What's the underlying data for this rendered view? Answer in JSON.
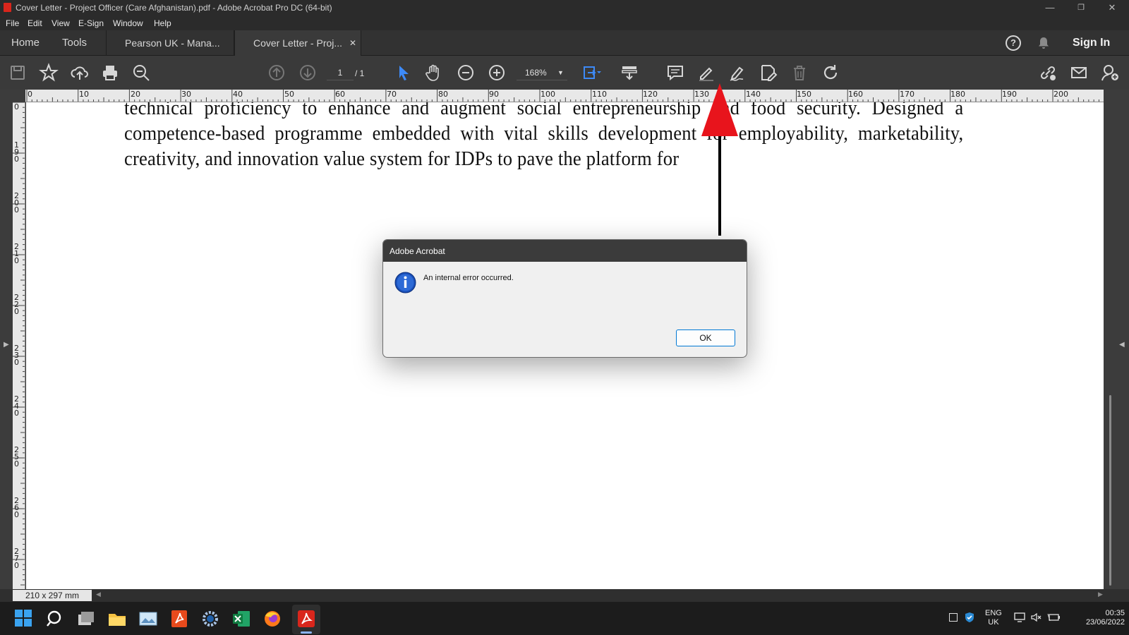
{
  "window": {
    "title": "Cover Letter - Project Officer (Care Afghanistan).pdf - Adobe Acrobat Pro DC (64-bit)",
    "controls": [
      "minimize",
      "restore",
      "close"
    ]
  },
  "menu": [
    "File",
    "Edit",
    "View",
    "E-Sign",
    "Window",
    "Help"
  ],
  "tabs": {
    "home": "Home",
    "tools": "Tools",
    "doc1": "Pearson UK - Mana...",
    "doc2": "Cover Letter - Proj...",
    "sign_in": "Sign In"
  },
  "toolbar": {
    "page_current": "1",
    "page_total": "/ 1",
    "zoom": "168%",
    "icons": [
      "save-icon",
      "bookmark-star-icon",
      "upload-cloud-icon",
      "print-icon",
      "zoom-search-icon",
      "page-up-icon",
      "page-down-icon",
      "select-arrow-icon",
      "hand-icon",
      "zoom-out-icon",
      "zoom-in-icon",
      "fit-page-icon",
      "scroll-mode-icon",
      "comment-icon",
      "highlight-pen-icon",
      "sign-pen-icon",
      "edit-pdf-icon",
      "delete-icon",
      "rotate-icon",
      "share-link-icon",
      "email-icon",
      "add-user-icon"
    ]
  },
  "ruler": {
    "h": [
      "0",
      "10",
      "20",
      "30",
      "40",
      "50",
      "60",
      "70",
      "80",
      "90",
      "100",
      "110",
      "120",
      "130",
      "140",
      "150",
      "160",
      "170",
      "180",
      "190",
      "200"
    ],
    "v": [
      "0",
      "190",
      "200",
      "210",
      "220",
      "230",
      "240",
      "250",
      "260",
      "270"
    ]
  },
  "document": {
    "lines": [
      "technical proficiency to enhance and augment social entrepreneurship and food security. Designed a",
      "competence-based programme embedded with vital skills development for employability, marketability,",
      "creativity, and innovation value system for IDPs to pave the platform for"
    ]
  },
  "dialog": {
    "title": "Adobe Acrobat",
    "message": "An internal error occurred.",
    "ok_label": "OK"
  },
  "status": {
    "page_size": "210 x 297 mm"
  },
  "taskbar": {
    "lang": "ENG",
    "region": "UK",
    "time": "00:35",
    "date": "23/06/2022"
  },
  "colors": {
    "accent": "#0078d4",
    "annotation_arrow": "#e8141c",
    "pdf_red": "#d9261c"
  }
}
